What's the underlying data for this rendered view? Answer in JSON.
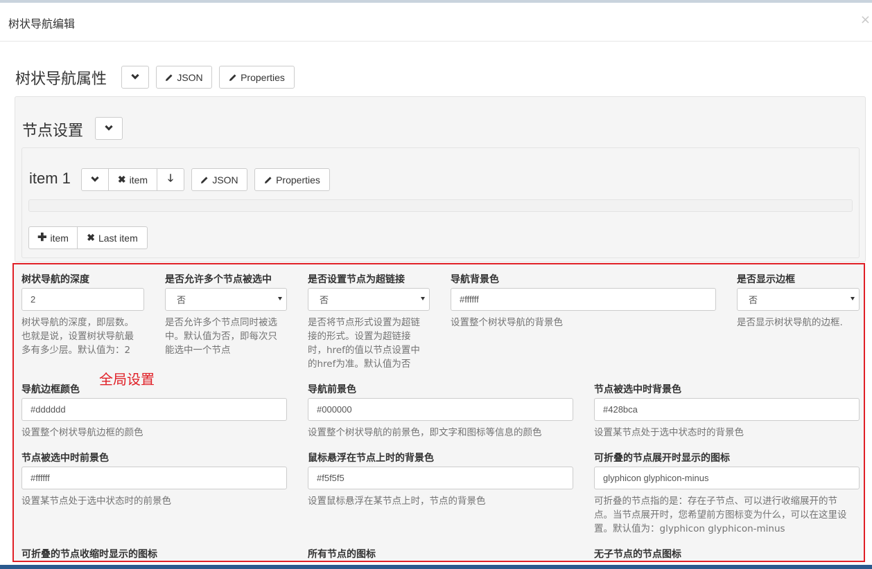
{
  "modal": {
    "title": "树状导航编辑",
    "close": "×"
  },
  "tree_props": {
    "title": "树状导航属性",
    "json_label": "JSON",
    "properties_label": "Properties"
  },
  "node_settings": {
    "title": "节点设置",
    "item": {
      "title": "item 1",
      "remove_label": "item",
      "json_label": "JSON",
      "properties_label": "Properties"
    },
    "add_item_label": "item",
    "remove_last_label": "Last item"
  },
  "global_note": "全局设置",
  "fields": [
    {
      "label": "树状导航的深度",
      "value": "2",
      "help": [
        "树状导航的深度，即层数。",
        "也就是说，设置树状导航最",
        "多有多少层。默认值为：2"
      ]
    },
    {
      "label": "是否允许多个节点被选中",
      "value": "否",
      "help": [
        "是否允许多个节点同时被选",
        "中。默认值为否，即每次只",
        "能选中一个节点"
      ]
    },
    {
      "label": "是否设置节点为超链接",
      "value": "否",
      "help": [
        "是否将节点形式设置为超链",
        "接的形式。设置为超链接",
        "时，href的值以节点设置中",
        "的href为准。默认值为否"
      ]
    },
    {
      "label": "导航背景色",
      "value": "#ffffff",
      "help": [
        "设置整个树状导航的背景色"
      ]
    },
    {
      "label": "是否显示边框",
      "value": "否",
      "help": [
        "是否显示树状导航的边框."
      ]
    },
    {
      "label": "导航边框颜色",
      "value": "#dddddd",
      "help": [
        "设置整个树状导航边框的颜色"
      ]
    },
    {
      "label": "导航前景色",
      "value": "#000000",
      "help": [
        "设置整个树状导航的前景色，即文字和图标等信息的颜色"
      ]
    },
    {
      "label": "节点被选中时背景色",
      "value": "#428bca",
      "help": [
        "设置某节点处于选中状态时的背景色"
      ]
    },
    {
      "label": "节点被选中时前景色",
      "value": "#ffffff",
      "help": [
        "设置某节点处于选中状态时的前景色"
      ]
    },
    {
      "label": "鼠标悬浮在节点上时的背景色",
      "value": "#f5f5f5",
      "help": [
        "设置鼠标悬浮在某节点上时，节点的背景色"
      ]
    },
    {
      "label": "可折叠的节点展开时显示的图标",
      "value": "glyphicon glyphicon-minus",
      "help": [
        "可折叠的节点指的是：存在子节点、可以进行收缩展开的节",
        "点。当节点展开时，您希望前方图标变为什么，可以在这里设",
        "置。默认值为：glyphicon glyphicon-minus"
      ]
    },
    {
      "label": "可折叠的节点收缩时显示的图标"
    },
    {
      "label": "所有节点的图标"
    },
    {
      "label": "无子节点的节点图标"
    }
  ],
  "icons": {
    "collapse": "chevron-down-icon",
    "edit": "pencil-icon",
    "remove": "x-icon",
    "add": "plus-icon",
    "move_down": "arrow-down-icon"
  },
  "colors": {
    "highlight_border": "#e01f26",
    "well_bg": "#f5f5f5"
  }
}
